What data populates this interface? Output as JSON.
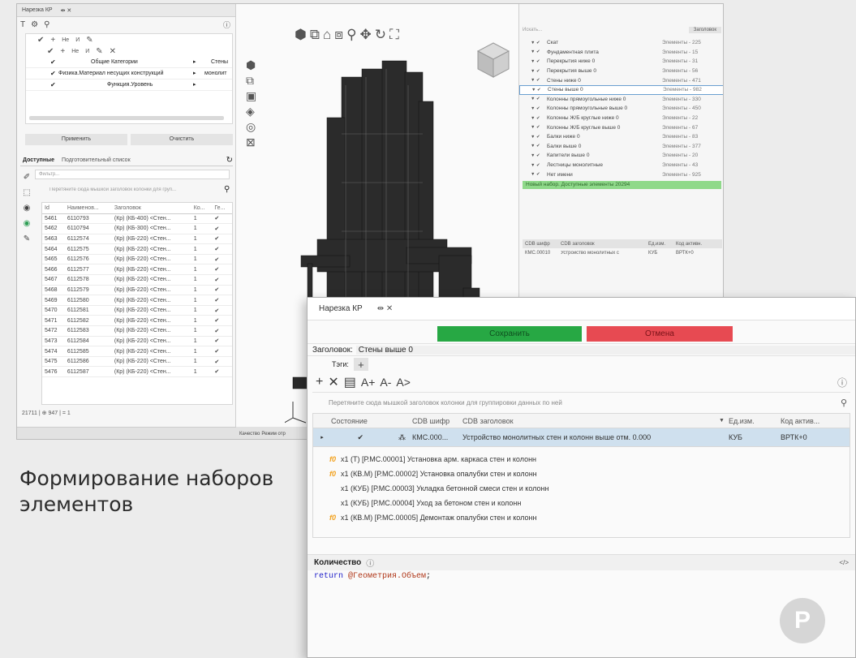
{
  "left_panel": {
    "window_title": "Нарезка КР",
    "tree_rows": [
      "Общие Категории",
      "Физика.Материал несущих конструкций",
      "Функция.Уровень"
    ],
    "tree_right": [
      "Стены",
      "монолит",
      ""
    ],
    "apply_label": "Применить",
    "clear_label": "Очистить",
    "tabs": [
      "Доступные",
      "Подготовительный список"
    ],
    "filter_placeholder": "Фильтр...",
    "group_hint": "Перетяните сюда мышкой заголовок колонки для груп...",
    "columns": [
      "Id",
      "Наименов...",
      "Заголовок",
      "Ко...",
      "Ге..."
    ],
    "rows": [
      {
        "id": "5461",
        "name": "6110793",
        "title": "(Кр) (КБ-400) <Стен..."
      },
      {
        "id": "5462",
        "name": "6110794",
        "title": "(Кр) (КБ-300) <Стен..."
      },
      {
        "id": "5463",
        "name": "6112574",
        "title": "(Кр) (КБ-220) <Стен..."
      },
      {
        "id": "5464",
        "name": "6112575",
        "title": "(Кр) (КБ-220) <Стен..."
      },
      {
        "id": "5465",
        "name": "6112576",
        "title": "(Кр) (КБ-220) <Стен..."
      },
      {
        "id": "5466",
        "name": "6112577",
        "title": "(Кр) (КБ-220) <Стен..."
      },
      {
        "id": "5467",
        "name": "6112578",
        "title": "(Кр) (КБ-220) <Стен..."
      },
      {
        "id": "5468",
        "name": "6112579",
        "title": "(Кр) (КБ-220) <Стен..."
      },
      {
        "id": "5469",
        "name": "6112580",
        "title": "(Кр) (КБ-220) <Стен..."
      },
      {
        "id": "5470",
        "name": "6112581",
        "title": "(Кр) (КБ-220) <Стен..."
      },
      {
        "id": "5471",
        "name": "6112582",
        "title": "(Кр) (КБ-220) <Стен..."
      },
      {
        "id": "5472",
        "name": "6112583",
        "title": "(Кр) (КБ-220) <Стен..."
      },
      {
        "id": "5473",
        "name": "6112584",
        "title": "(Кр) (КБ-220) <Стен..."
      },
      {
        "id": "5474",
        "name": "6112585",
        "title": "(Кр) (КБ-220) <Стен..."
      },
      {
        "id": "5475",
        "name": "6112586",
        "title": "(Кр) (КБ-220) <Стен..."
      },
      {
        "id": "5476",
        "name": "6112587",
        "title": "(Кр) (КБ-220) <Стен..."
      }
    ],
    "row_qty": "1",
    "status": "21711 | ⊕ 947 | = 1"
  },
  "viewport": {
    "bottom_labels": [
      "Качество",
      "Режим отр"
    ]
  },
  "sets_panel": {
    "search_placeholder": "Искать...",
    "search_right": "Заголовок",
    "items": [
      {
        "name": "Скат",
        "count": "Элементы - 225"
      },
      {
        "name": "Фундаментная плита",
        "count": "Элементы - 15"
      },
      {
        "name": "Перекрытия ниже 0",
        "count": "Элементы - 31"
      },
      {
        "name": "Перекрытия выше 0",
        "count": "Элементы - 56"
      },
      {
        "name": "Стены ниже 0",
        "count": "Элементы - 471"
      },
      {
        "name": "Стены выше 0",
        "count": "Элементы - 982"
      },
      {
        "name": "Колонны прямоугольные ниже 0",
        "count": "Элементы - 330"
      },
      {
        "name": "Колонны прямоугольные выше 0",
        "count": "Элементы - 450"
      },
      {
        "name": "Колонны Ж/Б круглые ниже 0",
        "count": "Элементы - 22"
      },
      {
        "name": "Колонны Ж/Б круглые выше 0",
        "count": "Элементы - 67"
      },
      {
        "name": "Балки ниже 0",
        "count": "Элементы - 83"
      },
      {
        "name": "Балки выше 0",
        "count": "Элементы - 377"
      },
      {
        "name": "Капители выше 0",
        "count": "Элементы - 20"
      },
      {
        "name": "Лестницы монолитные",
        "count": "Элементы - 43"
      },
      {
        "name": "Нет имени",
        "count": "Элементы - 925"
      }
    ],
    "new_set": "Новый набор. Доступные элементы 20294",
    "bottom_columns": [
      "CDB шифр",
      "CDB заголовок",
      "Ед.изм.",
      "Код активн."
    ],
    "bottom_row": [
      "КМС.00010",
      "Устройство монолитных с",
      "КУБ",
      "ВРТК+0"
    ]
  },
  "front": {
    "title": "Нарезка КР",
    "title_icons": "⇹ ✕",
    "save_label": "Сохранить",
    "cancel_label": "Отмена",
    "heading_label": "Заголовок:",
    "heading_value": "Стены выше 0",
    "tags_label": "Тэги:",
    "group_hint": "Перетяните сюда мышкой заголовок колонки для группировки данных по ней",
    "columns": [
      "Состояние",
      "CDB шифр",
      "CDB заголовок",
      "Ед.изм.",
      "Код актив..."
    ],
    "row": {
      "code": "КМС.000...",
      "title": "Устройство монолитных стен и колонн выше отм. 0.000",
      "unit": "КУБ",
      "act": "ВРТК+0"
    },
    "ops": [
      {
        "prefix": "f0",
        "text": "x1 (Т) [Р.МС.00001] Установка арм. каркаса стен и колонн"
      },
      {
        "prefix": "f0",
        "text": "x1 (КВ.М) [Р.МС.00002] Установка опалубки стен и колонн"
      },
      {
        "prefix": "",
        "text": "x1 (КУБ) [Р.МС.00003] Укладка бетонной смеси стен и колонн"
      },
      {
        "prefix": "",
        "text": "x1 (КУБ) [Р.МС.00004] Уход за бетоном стен и колонн"
      },
      {
        "prefix": "f0",
        "text": "x1 (КВ.М) [Р.МС.00005] Демонтаж опалубки стен и колонн"
      }
    ],
    "qty_label": "Количество",
    "code_return": "return",
    "code_expr": "@Геометрия.Объем",
    "code_end": ";",
    "code_toggle": "</>"
  },
  "caption": {
    "line1": "Формирование наборов",
    "line2": "элементов"
  },
  "colors": {
    "save": "#27a844",
    "cancel": "#e74a52",
    "accent": "#f2a11d",
    "code_keyword": "#2121c9",
    "code_expr": "#b0381a",
    "new_set": "#8fd98a",
    "selected": "#cfe0ee"
  }
}
